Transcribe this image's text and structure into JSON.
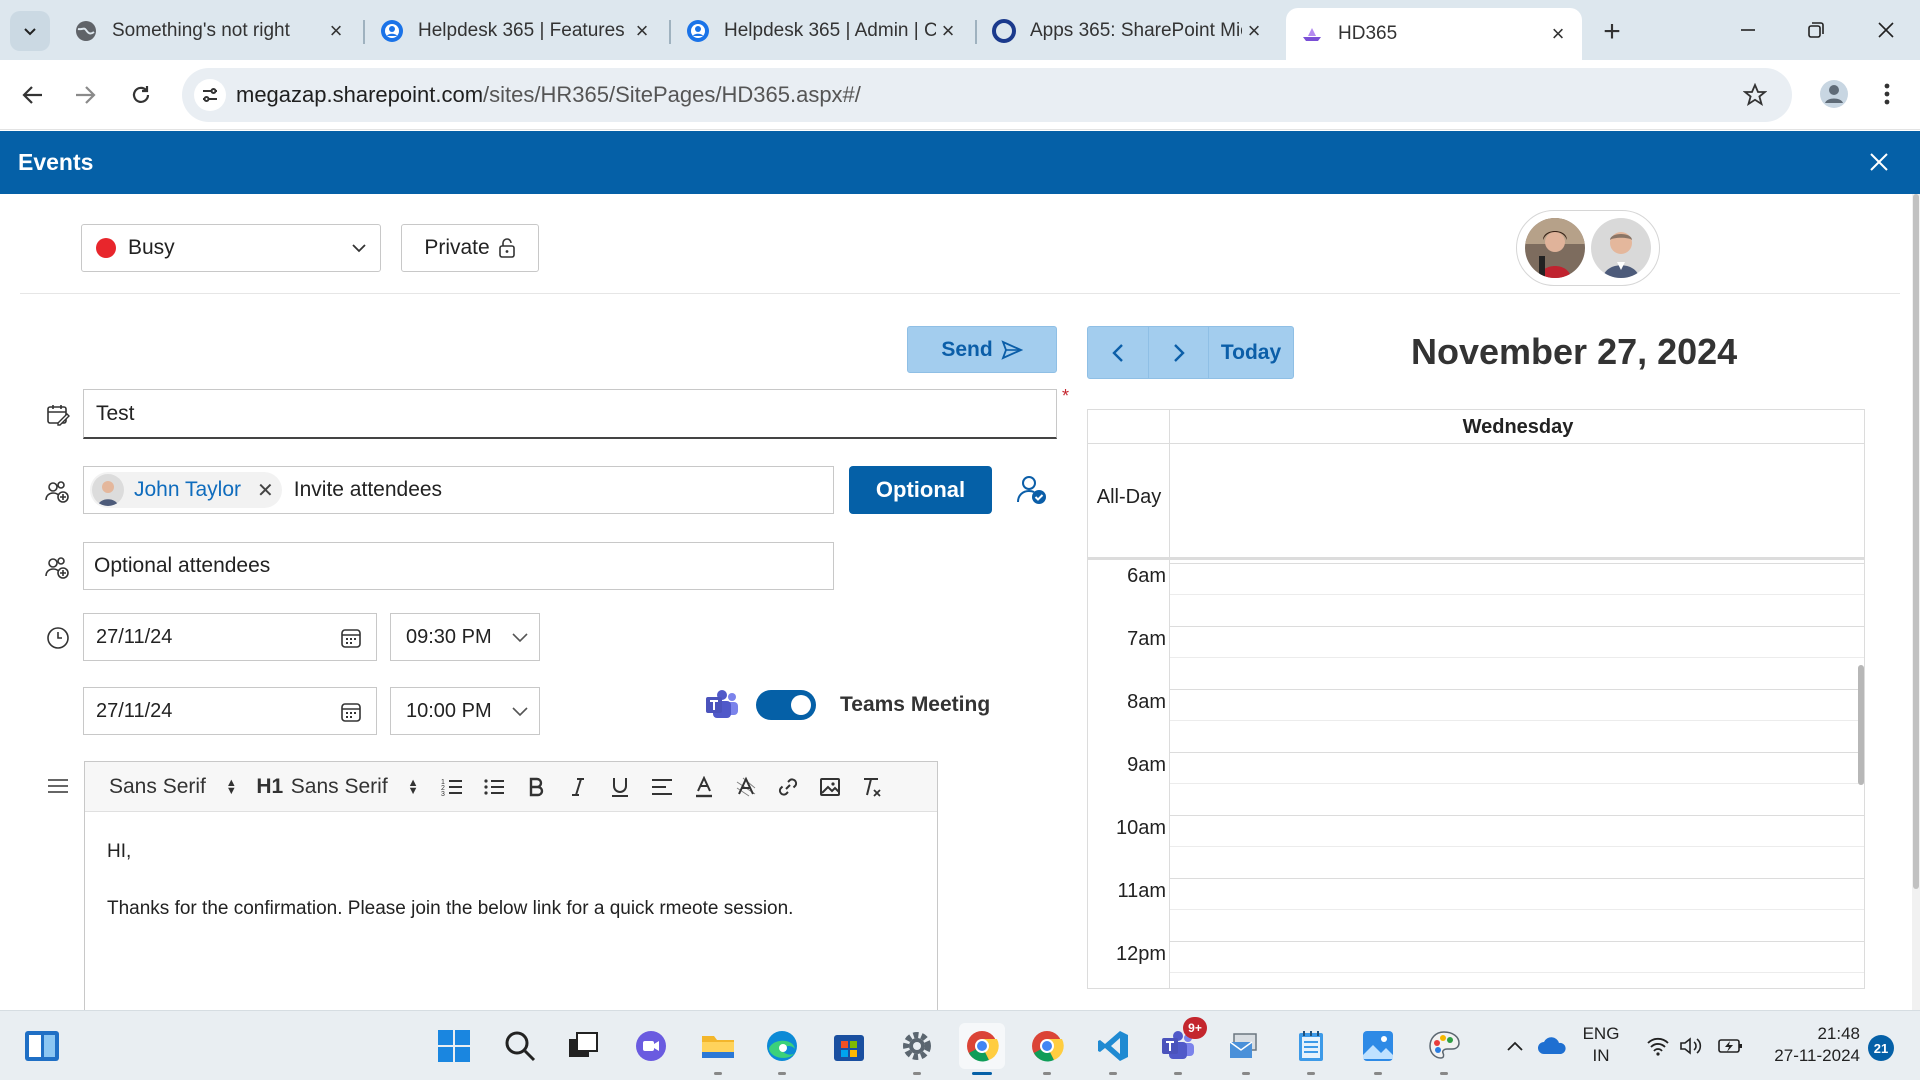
{
  "browser": {
    "tabs": [
      {
        "label": "Something's not right",
        "icon": "globe-icon"
      },
      {
        "label": "Helpdesk 365 | Features",
        "icon": "helpdesk-icon"
      },
      {
        "label": "Helpdesk 365 | Admin | C",
        "icon": "helpdesk-icon"
      },
      {
        "label": "Apps 365: SharePoint Mic",
        "icon": "apps365-icon"
      },
      {
        "label": "HD365",
        "icon": "hd365-icon"
      }
    ],
    "url_host": "megazap.sharepoint.com",
    "url_path": "/sites/HR365/SitePages/HD365.aspx#/"
  },
  "panel": {
    "title": "Events"
  },
  "form": {
    "status": "Busy",
    "private_label": "Private",
    "send_label": "Send",
    "title_value": "Test",
    "required_mark": "*",
    "attendee_name": "John Taylor",
    "attendees_placeholder": "Invite attendees",
    "optional_label": "Optional",
    "optional_placeholder": "Optional attendees",
    "start_date": "27/11/24",
    "start_time": "09:30 PM",
    "end_date": "27/11/24",
    "end_time": "10:00 PM",
    "teams_label": "Teams Meeting",
    "teams_enabled": true
  },
  "editor": {
    "font_1": "Sans Serif",
    "heading": "H1",
    "font_2": "Sans Serif",
    "body_line_1": "HI,",
    "body_line_2": "Thanks for the confirmation. Please join the below link for a quick rmeote session."
  },
  "calendar": {
    "today_label": "Today",
    "date_title": "November 27, 2024",
    "day_name": "Wednesday",
    "allday_label": "All-Day",
    "hours": [
      "6am",
      "7am",
      "8am",
      "9am",
      "10am",
      "11am",
      "12pm"
    ]
  },
  "taskbar": {
    "teams_badge": "9+",
    "lang_1": "ENG",
    "lang_2": "IN",
    "time": "21:48",
    "date": "27-11-2024",
    "notifications": "21"
  },
  "colors": {
    "brand_blue": "#0560a7",
    "light_blue": "#a3cdee",
    "busy_red": "#e8262c"
  }
}
